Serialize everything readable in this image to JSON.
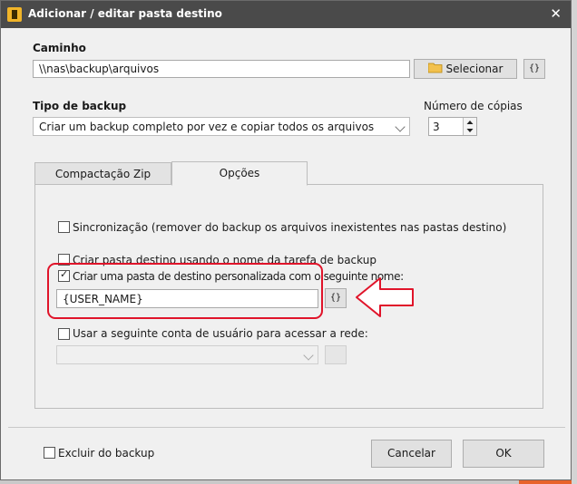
{
  "window": {
    "title": "Adicionar / editar pasta destino",
    "close_glyph": "✕"
  },
  "path": {
    "label": "Caminho",
    "value": "\\\\nas\\backup\\arquivos",
    "select_label": "Selecionar",
    "vars_label": "{}"
  },
  "backup_type": {
    "label": "Tipo de backup",
    "value": "Criar um backup completo por vez e copiar todos os arquivos"
  },
  "copies": {
    "label": "Número de cópias",
    "value": "3"
  },
  "tabs": [
    {
      "label": "Compactação Zip",
      "active": false
    },
    {
      "label": "Opções",
      "active": true
    }
  ],
  "options": {
    "sync_label": "Sincronização (remover do backup os arquivos inexistentes nas pastas destino)",
    "sync_checked": false,
    "task_folder_label": "Criar pasta destino usando o nome da tarefa de backup",
    "task_folder_checked": false,
    "custom_folder_label": "Criar uma pasta de destino personalizada com o seguinte nome:",
    "custom_folder_checked": true,
    "custom_folder_value": "{USER_NAME}",
    "custom_vars_label": "{}",
    "network_account_label": "Usar a seguinte conta de usuário para acessar a rede:",
    "network_account_checked": false,
    "network_account_value": ""
  },
  "footer": {
    "exclude_label": "Excluir do backup",
    "exclude_checked": false,
    "cancel_label": "Cancelar",
    "ok_label": "OK"
  },
  "colors": {
    "titlebar": "#4a4a4a",
    "annotation": "#e0142a",
    "accent_orange": "#e8622a",
    "folder_icon": "#f2c14e"
  },
  "icons": [
    "app-icon",
    "close-icon",
    "folder-icon",
    "chevron-down-icon",
    "spin-up-icon",
    "spin-down-icon",
    "arrow-annotation-icon"
  ]
}
